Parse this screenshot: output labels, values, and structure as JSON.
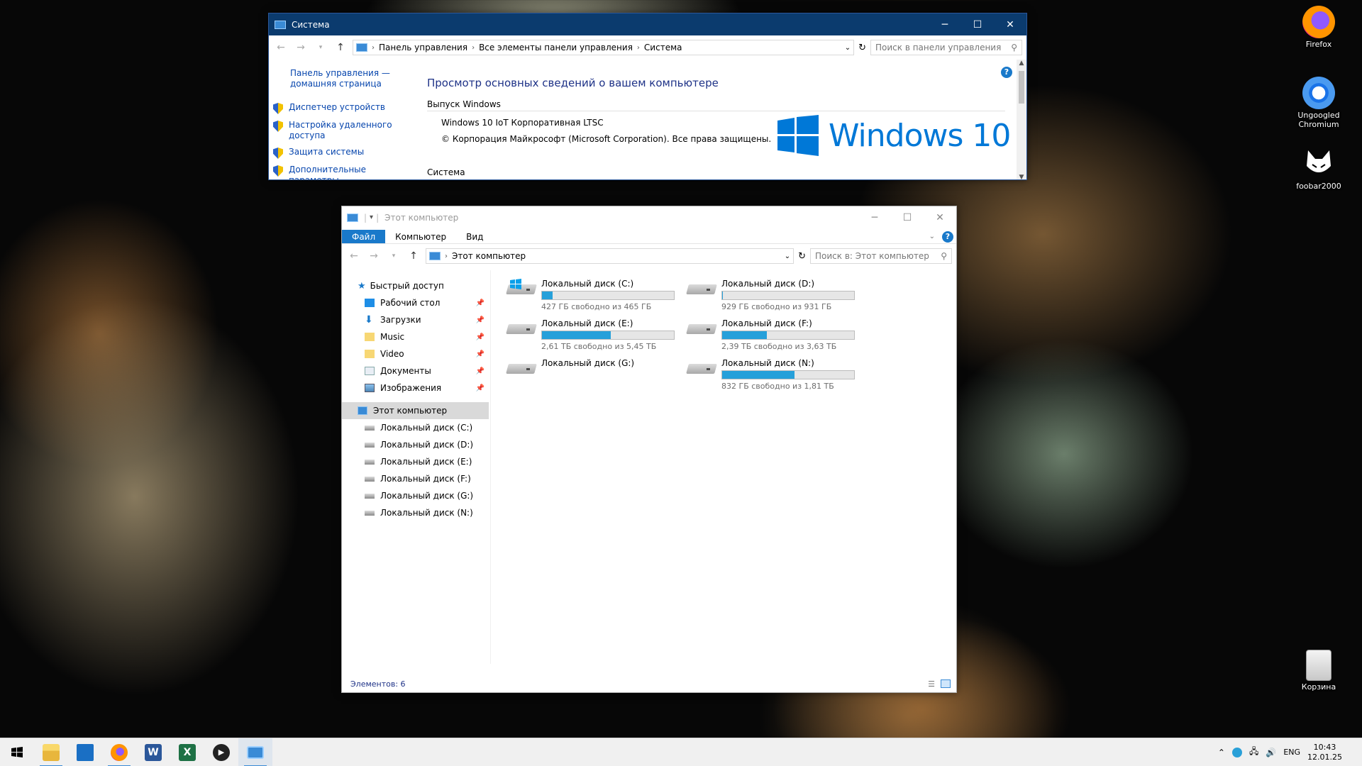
{
  "system_window": {
    "title": "Система",
    "breadcrumb": [
      "Панель управления",
      "Все элементы панели управления",
      "Система"
    ],
    "search_placeholder": "Поиск в панели управления",
    "sidebar": {
      "home_link": "Панель управления — домашняя страница",
      "items": [
        {
          "label": "Диспетчер устройств"
        },
        {
          "label": "Настройка удаленного доступа"
        },
        {
          "label": "Защита системы"
        },
        {
          "label": "Дополнительные параметры"
        }
      ]
    },
    "heading": "Просмотр основных сведений о вашем компьютере",
    "edition_section": "Выпуск Windows",
    "edition_name": "Windows 10 IoT Корпоративная LTSC",
    "copyright": "© Корпорация Майкрософт (Microsoft Corporation). Все права защищены.",
    "logo_text": "Windows 10",
    "system_section": "Система",
    "help": "?"
  },
  "explorer_window": {
    "title": "Этот компьютер",
    "ribbon_tabs": [
      "Файл",
      "Компьютер",
      "Вид"
    ],
    "address": "Этот компьютер",
    "search_placeholder": "Поиск в: Этот компьютер",
    "help": "?",
    "quick_access": {
      "label": "Быстрый доступ",
      "items": [
        {
          "label": "Рабочий стол",
          "icon": "desktop-folder-icon"
        },
        {
          "label": "Загрузки",
          "icon": "downloads-icon"
        },
        {
          "label": "Music",
          "icon": "folder-icon"
        },
        {
          "label": "Video",
          "icon": "folder-icon"
        },
        {
          "label": "Документы",
          "icon": "documents-icon"
        },
        {
          "label": "Изображения",
          "icon": "pictures-icon"
        }
      ]
    },
    "this_pc": {
      "label": "Этот компьютер",
      "drives": [
        {
          "label": "Локальный диск (C:)"
        },
        {
          "label": "Локальный диск (D:)"
        },
        {
          "label": "Локальный диск (E:)"
        },
        {
          "label": "Локальный диск (F:)"
        },
        {
          "label": "Локальный диск (G:)"
        },
        {
          "label": "Локальный диск (N:)"
        }
      ]
    },
    "drive_tiles": [
      {
        "name": "Локальный диск (C:)",
        "free": "427 ГБ свободно из 465 ГБ",
        "used_fraction": 0.08,
        "system": true
      },
      {
        "name": "Локальный диск (D:)",
        "free": "929 ГБ свободно из 931 ГБ",
        "used_fraction": 0.002
      },
      {
        "name": "Локальный диск (E:)",
        "free": "2,61 ТБ свободно из 5,45 ТБ",
        "used_fraction": 0.52
      },
      {
        "name": "Локальный диск (F:)",
        "free": "2,39 ТБ свободно из 3,63 ТБ",
        "used_fraction": 0.34
      },
      {
        "name": "Локальный диск (G:)",
        "free": "",
        "used_fraction": null
      },
      {
        "name": "Локальный диск (N:)",
        "free": "832 ГБ свободно из 1,81 ТБ",
        "used_fraction": 0.55
      }
    ],
    "status": "Элементов: 6"
  },
  "desktop_icons": [
    {
      "label": "Firefox",
      "icon": "firefox-icon"
    },
    {
      "label": "Ungoogled Chromium",
      "icon": "chromium-icon"
    },
    {
      "label": "foobar2000",
      "icon": "foobar-icon"
    },
    {
      "label": "Корзина",
      "icon": "recycle-bin-icon"
    }
  ],
  "taskbar": {
    "apps": [
      {
        "name": "file-explorer",
        "icon": "folder-icon"
      },
      {
        "name": "store",
        "icon": "store-icon"
      },
      {
        "name": "firefox",
        "icon": "firefox-icon"
      },
      {
        "name": "word",
        "icon": "word-icon"
      },
      {
        "name": "excel",
        "icon": "excel-icon"
      },
      {
        "name": "media-player",
        "icon": "play-icon"
      },
      {
        "name": "control-panel",
        "icon": "system-icon"
      }
    ],
    "language": "ENG",
    "time": "10:43",
    "date": "12.01.25"
  },
  "colors": {
    "titlebar_active": "#0b3b6e",
    "link": "#0645ad",
    "accent": "#1979ca",
    "drive_fill": "#26a0da"
  }
}
